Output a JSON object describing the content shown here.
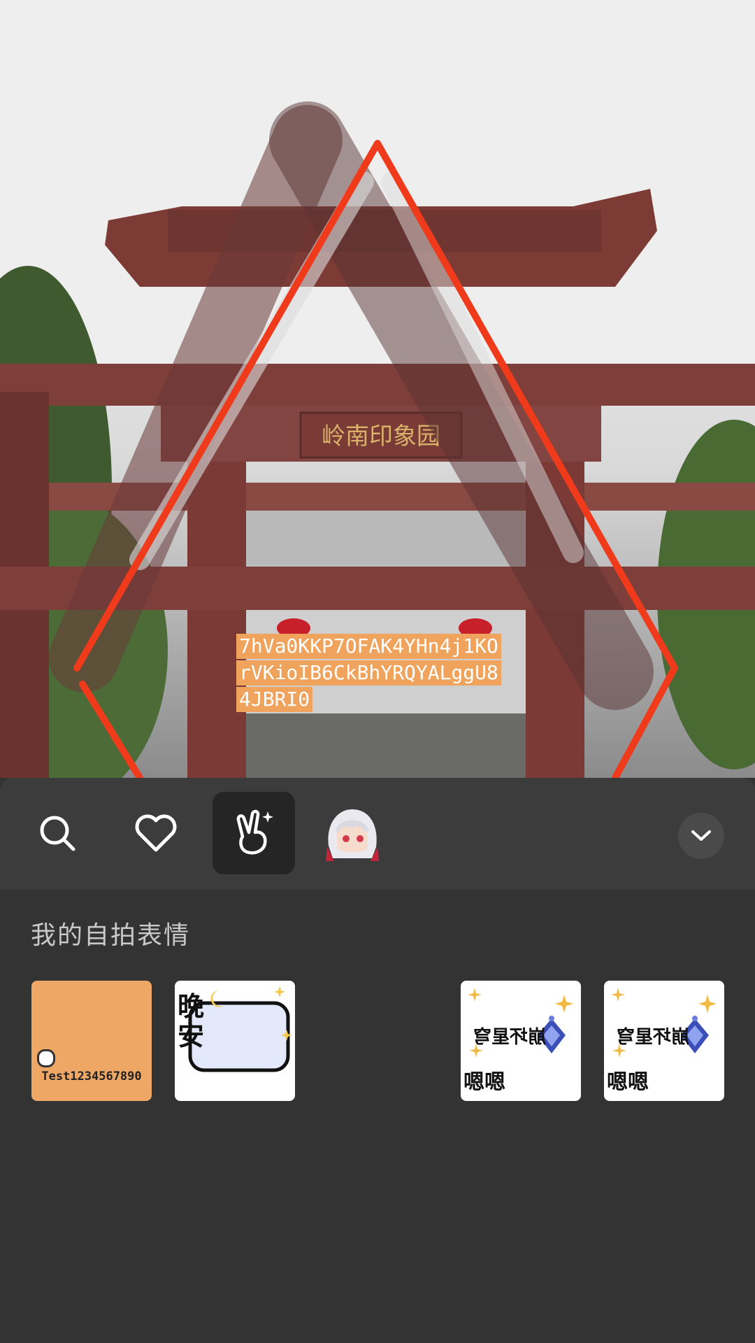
{
  "photo": {
    "overlay_text_lines": [
      "7hVa0KKP7OFAK4YHn4j1KO",
      "rVKioIB6CkBhYRQYALggU8",
      "4JBRI0"
    ],
    "gate_sign": "岭南印象园"
  },
  "toolbar": {
    "tabs": [
      {
        "id": "search",
        "icon": "search-icon",
        "active": false
      },
      {
        "id": "favorites",
        "icon": "heart-icon",
        "active": false
      },
      {
        "id": "selfie",
        "icon": "victory-hand-icon",
        "active": true
      },
      {
        "id": "avatar",
        "icon": "anime-avatar-icon",
        "active": false
      }
    ],
    "collapse_icon": "chevron-down-icon"
  },
  "section": {
    "title": "我的自拍表情"
  },
  "stickers": [
    {
      "type": "text",
      "caption": "Test1234567890"
    },
    {
      "type": "goodnight",
      "text_top": "晚",
      "text_bottom": "安"
    },
    {
      "type": "logo",
      "bottom_text": "嗯嗯",
      "logo_text": "崩坏星穹"
    },
    {
      "type": "logo",
      "bottom_text": "嗯嗯",
      "logo_text": "崩坏星穹"
    }
  ],
  "colors": {
    "panel_bg": "#333333",
    "toolbar_bg": "#3c3c3c",
    "active_tab_bg": "#252525",
    "overlay_text_bg": "#f0a35c",
    "stroke_red": "#ef3b1b"
  }
}
